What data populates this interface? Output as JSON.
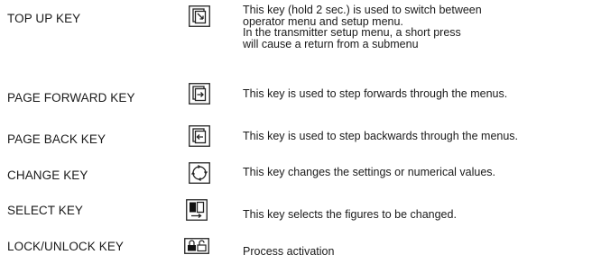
{
  "keys": [
    {
      "name": "TOP  UP KEY",
      "icon": "top-up-key-icon",
      "description_lines": [
        "This key (hold 2 sec.) is used to switch between",
        "operator menu and setup menu.",
        "In the transmitter setup menu, a short press",
        "will cause a return from a submenu"
      ]
    },
    {
      "name": "PAGE FORWARD KEY",
      "icon": "page-forward-key-icon",
      "description_lines": [
        "This key is used to step forwards through the menus."
      ]
    },
    {
      "name": "PAGE BACK KEY",
      "icon": "page-back-key-icon",
      "description_lines": [
        "This key is used to step backwards through the menus."
      ]
    },
    {
      "name": "CHANGE KEY",
      "icon": "change-key-icon",
      "description_lines": [
        "This key changes the settings or numerical values."
      ]
    },
    {
      "name": "SELECT KEY",
      "icon": "select-key-icon",
      "description_lines": [
        "This key selects the figures to be changed."
      ]
    },
    {
      "name": "LOCK/UNLOCK KEY",
      "icon": "lock-unlock-key-icon",
      "description_lines": [
        "Process activation"
      ]
    }
  ]
}
